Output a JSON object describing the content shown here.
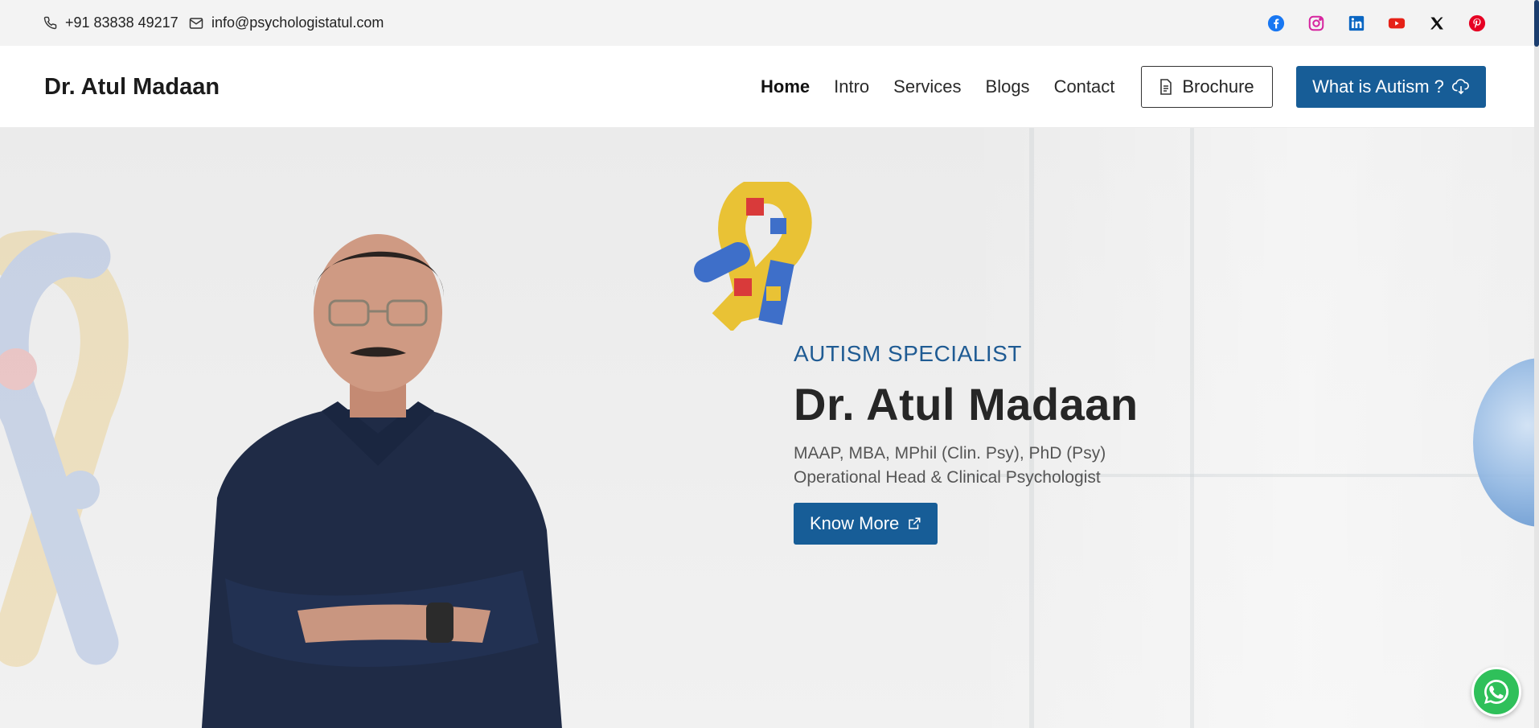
{
  "topbar": {
    "phone": "+91 83838 49217",
    "email": "info@psychologistatul.com",
    "socials": [
      "facebook-icon",
      "instagram-icon",
      "linkedin-icon",
      "youtube-icon",
      "x-icon",
      "pinterest-icon"
    ]
  },
  "header": {
    "brand": "Dr. Atul Madaan",
    "nav": [
      "Home",
      "Intro",
      "Services",
      "Blogs",
      "Contact"
    ],
    "active_nav": "Home",
    "brochure_label": "Brochure",
    "autism_label": "What is Autism ?"
  },
  "hero": {
    "eyebrow": "AUTISM SPECIALIST",
    "title": "Dr. Atul Madaan",
    "qualifications": "MAAP, MBA, MPhil (Clin. Psy), PhD (Psy)",
    "role": "Operational Head & Clinical Psychologist",
    "cta_label": "Know More"
  },
  "colors": {
    "accent": "#175d97",
    "topbar_bg": "#f3f3f3",
    "whatsapp": "#2fc05a"
  }
}
